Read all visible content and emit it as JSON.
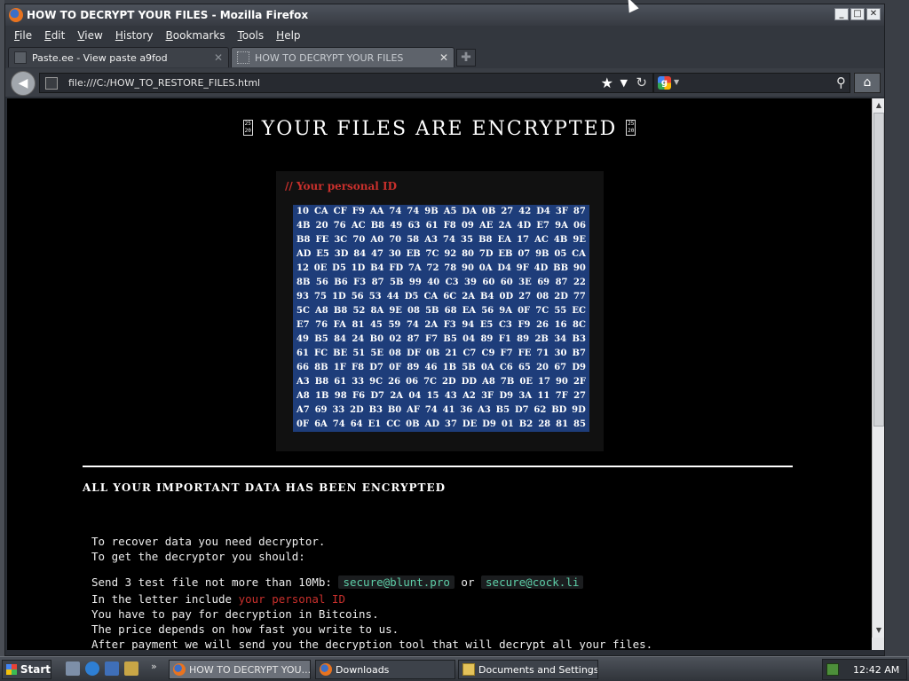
{
  "window": {
    "title": "HOW TO DECRYPT YOUR FILES - Mozilla Firefox",
    "controls": [
      "_",
      "□",
      "✕"
    ]
  },
  "menu": [
    "File",
    "Edit",
    "View",
    "History",
    "Bookmarks",
    "Tools",
    "Help"
  ],
  "tabs": [
    {
      "label": "Paste.ee - View paste a9fod",
      "close": "✕"
    },
    {
      "label": "HOW TO DECRYPT YOUR FILES",
      "close": "✕"
    }
  ],
  "new_tab_icon": "✚",
  "url": "file:///C:/HOW_TO_RESTORE_FILES.html",
  "icons": {
    "back": "◀",
    "star": "★",
    "dropdown": "▼",
    "reload": "↻",
    "search_engine": "g",
    "search_dropdown": "▼",
    "search": "⚲",
    "home": "⌂",
    "scroll_up": "▲",
    "scroll_down": "▼",
    "quicklaunch_more": "»"
  },
  "page": {
    "heading": "YOUR FILES ARE ENCRYPTED",
    "heading_glyph": "25 20",
    "id_label": "// Your personal ID",
    "hex_rows": [
      [
        "10",
        "CA",
        "CF",
        "F9",
        "AA",
        "74",
        "74",
        "9B",
        "A5",
        "DA",
        "0B",
        "27",
        "42",
        "D4",
        "3F",
        "87"
      ],
      [
        "4B",
        "20",
        "76",
        "AC",
        "B8",
        "49",
        "63",
        "61",
        "F8",
        "09",
        "AE",
        "2A",
        "4D",
        "E7",
        "9A",
        "06"
      ],
      [
        "B8",
        "FE",
        "3C",
        "70",
        "A0",
        "70",
        "58",
        "A3",
        "74",
        "35",
        "B8",
        "EA",
        "17",
        "AC",
        "4B",
        "9E"
      ],
      [
        "AD",
        "E5",
        "3D",
        "84",
        "47",
        "30",
        "EB",
        "7C",
        "92",
        "80",
        "7D",
        "EB",
        "07",
        "9B",
        "05",
        "CA"
      ],
      [
        "12",
        "0E",
        "D5",
        "1D",
        "B4",
        "FD",
        "7A",
        "72",
        "78",
        "90",
        "0A",
        "D4",
        "9F",
        "4D",
        "BB",
        "90"
      ],
      [
        "8B",
        "56",
        "B6",
        "F3",
        "87",
        "5B",
        "99",
        "40",
        "C3",
        "39",
        "60",
        "60",
        "3E",
        "69",
        "87",
        "22"
      ],
      [
        "93",
        "75",
        "1D",
        "56",
        "53",
        "44",
        "D5",
        "CA",
        "6C",
        "2A",
        "B4",
        "0D",
        "27",
        "08",
        "2D",
        "77"
      ],
      [
        "5C",
        "A8",
        "B8",
        "52",
        "8A",
        "9E",
        "08",
        "5B",
        "68",
        "EA",
        "56",
        "9A",
        "0F",
        "7C",
        "55",
        "EC"
      ],
      [
        "E7",
        "76",
        "FA",
        "81",
        "45",
        "59",
        "74",
        "2A",
        "F3",
        "94",
        "E5",
        "C3",
        "F9",
        "26",
        "16",
        "8C"
      ],
      [
        "49",
        "B5",
        "84",
        "24",
        "B0",
        "02",
        "87",
        "F7",
        "B5",
        "04",
        "89",
        "F1",
        "89",
        "2B",
        "34",
        "B3"
      ],
      [
        "61",
        "FC",
        "BE",
        "51",
        "5E",
        "08",
        "DF",
        "0B",
        "21",
        "C7",
        "C9",
        "F7",
        "FE",
        "71",
        "30",
        "B7"
      ],
      [
        "66",
        "8B",
        "1F",
        "F8",
        "D7",
        "0F",
        "89",
        "46",
        "1B",
        "5B",
        "0A",
        "C6",
        "65",
        "20",
        "67",
        "D9"
      ],
      [
        "A3",
        "B8",
        "61",
        "33",
        "9C",
        "26",
        "06",
        "7C",
        "2D",
        "DD",
        "A8",
        "7B",
        "0E",
        "17",
        "90",
        "2F"
      ],
      [
        "A8",
        "1B",
        "98",
        "F6",
        "D7",
        "2A",
        "04",
        "15",
        "43",
        "A2",
        "3F",
        "D9",
        "3A",
        "11",
        "7F",
        "27"
      ],
      [
        "A7",
        "69",
        "33",
        "2D",
        "B3",
        "B0",
        "AF",
        "74",
        "41",
        "36",
        "A3",
        "B5",
        "D7",
        "62",
        "BD",
        "9D"
      ],
      [
        "0F",
        "6A",
        "74",
        "64",
        "E1",
        "CC",
        "0B",
        "AD",
        "37",
        "DE",
        "D9",
        "01",
        "B2",
        "28",
        "81",
        "85"
      ]
    ],
    "important": "ALL YOUR IMPORTANT DATA HAS BEEN ENCRYPTED",
    "recover_line": "To recover data you need decryptor.",
    "get_line": "To get the decryptor you should:",
    "send_text": "Send 3 test file not more than 10Mb:",
    "email_1": "secure@blunt.pro",
    "or_text": "or",
    "email_2": "secure@cock.li",
    "include_text": "In the letter include",
    "include_link": "your personal ID",
    "pay_line": "You have to pay for decryption in Bitcoins.",
    "price_line": "The price depends on how fast you write to us.",
    "after_line": "After payment we will send you the decryption tool that will decrypt all your files."
  },
  "taskbar": {
    "start": "Start",
    "tasks": [
      "HOW TO DECRYPT YOU...",
      "Downloads",
      "Documents and Settings"
    ],
    "clock": "12:42 AM"
  }
}
